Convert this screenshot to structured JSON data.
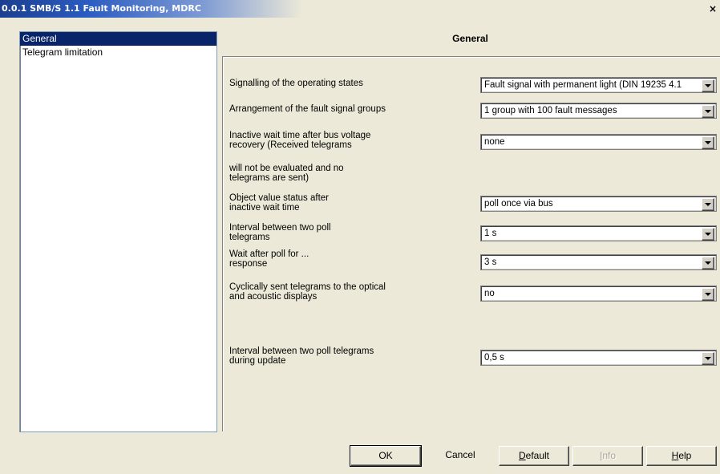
{
  "window": {
    "title": "0.0.1 SMB/S 1.1 Fault Monitoring, MDRC",
    "close_glyph": "×"
  },
  "sidebar": {
    "items": [
      {
        "label": "General",
        "selected": true
      },
      {
        "label": "Telegram limitation",
        "selected": false
      }
    ]
  },
  "panel": {
    "title": "General",
    "rows": [
      {
        "label": "Signalling of the operating states",
        "value": "Fault signal with permanent light (DIN 19235 4.1"
      },
      {
        "label": "Arrangement of the fault signal groups",
        "value": "1 group with 100 fault messages"
      },
      {
        "label": "Inactive wait time after bus voltage\nrecovery (Received telegrams",
        "value": "none"
      },
      {
        "label": "will not be evaluated and no\ntelegrams are sent)",
        "value": null
      },
      {
        "label": "Object value status after\n inactive wait time",
        "value": "poll once via bus"
      },
      {
        "label": "  Interval between two poll\n  telegrams",
        "value": "1 s"
      },
      {
        "label": "Wait after poll for ...\nresponse",
        "value": "3 s"
      },
      {
        "label": "Cyclically sent telegrams to the optical\n and acoustic displays",
        "value": "no"
      },
      {
        "label": "Interval between two poll telegrams\nduring update",
        "value": "0,5 s"
      }
    ]
  },
  "buttons": {
    "ok": "OK",
    "cancel": "Cancel",
    "default_first": "D",
    "default_rest": "efault",
    "info_first": "I",
    "info_rest": "nfo",
    "help_first": "H",
    "help_rest": "elp"
  }
}
